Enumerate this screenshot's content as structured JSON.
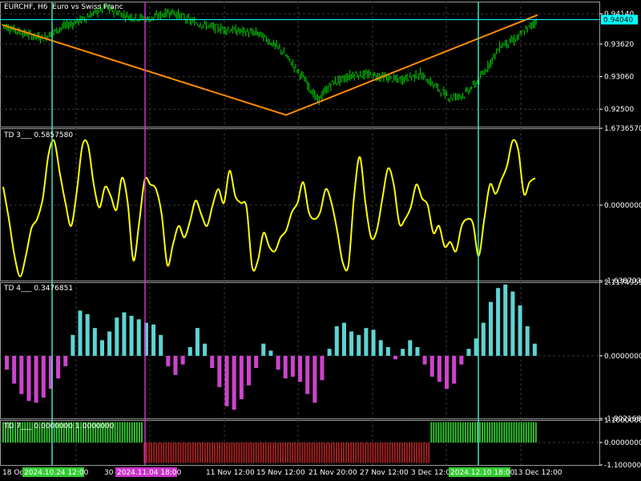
{
  "window": {
    "symbol_label": "EURCHF, H6",
    "description": "Euro vs Swiss Franc"
  },
  "colors": {
    "background": "#000000",
    "grid": "#3a3a3a",
    "candles": "#00e000",
    "trendline": "#ff8c00",
    "vline_cyan": "#40e0c0",
    "vline_magenta": "#cc33cc",
    "td3_line": "#ffff00",
    "td4_up": "#5fd3d3",
    "td4_down": "#cc44cc",
    "td7_up": "#33cc33",
    "td7_down": "#aa2222",
    "price_tag": "#00ffff"
  },
  "price_panel": {
    "current_price_label": "0.94040",
    "axis_labels": [
      "0.94140",
      "0.93620",
      "0.93060",
      "0.92500"
    ],
    "ylim": [
      0.922,
      0.9435
    ]
  },
  "td3_panel": {
    "title": "TD 3___ 0.5857580",
    "axis_labels": [
      "1.6736570",
      "0.0000000",
      "-1.6387039"
    ],
    "ylim": [
      -1.6387039,
      1.673657
    ]
  },
  "td4_panel": {
    "title": "TD 4___ 0.3476851",
    "axis_labels": [
      "2.1174959",
      "0.0000000",
      "-1.8021682"
    ],
    "ylim": [
      -1.8021682,
      2.1174959
    ]
  },
  "td7_panel": {
    "title": "TD 7___ 0.0000000 1.0000000",
    "axis_labels": [
      "1.1000000",
      "0.0000000",
      "-1.1000000"
    ],
    "ylim": [
      -1.1,
      1.1
    ]
  },
  "time_axis": {
    "labels": [
      "18 Oct",
      "30",
      "11 Nov 12:00",
      "15 Nov 12:00",
      "21 Nov 20:00",
      "27 Nov 12:00",
      "3 Dec 12:00",
      "13 Dec 12:00"
    ],
    "highlight_labels": [
      {
        "text": "2024.10.24 12:00",
        "color": "#33cc33"
      },
      {
        "text": "2024.11.04 18:00",
        "color": "#cc33cc"
      },
      {
        "text": "2024.12.10 18:00",
        "color": "#33cc33"
      }
    ]
  },
  "chart_data": [
    {
      "type": "candlestick",
      "title": "EURCHF, H6",
      "ylim": [
        0.922,
        0.9435
      ],
      "price_key_points": [
        [
          0,
          0.9395
        ],
        [
          15,
          0.938
        ],
        [
          28,
          0.9372
        ],
        [
          40,
          0.939
        ],
        [
          55,
          0.9405
        ],
        [
          70,
          0.9425
        ],
        [
          85,
          0.941
        ],
        [
          100,
          0.9405
        ],
        [
          115,
          0.9418
        ],
        [
          130,
          0.94
        ],
        [
          145,
          0.939
        ],
        [
          160,
          0.9385
        ],
        [
          175,
          0.938
        ],
        [
          190,
          0.9352
        ],
        [
          205,
          0.9305
        ],
        [
          215,
          0.9265
        ],
        [
          225,
          0.9295
        ],
        [
          240,
          0.931
        ],
        [
          255,
          0.9308
        ],
        [
          270,
          0.93
        ],
        [
          285,
          0.931
        ],
        [
          295,
          0.929
        ],
        [
          305,
          0.927
        ],
        [
          315,
          0.9275
        ],
        [
          325,
          0.93
        ],
        [
          340,
          0.936
        ],
        [
          350,
          0.937
        ],
        [
          365,
          0.9404
        ]
      ],
      "trendline": [
        [
          0.0,
          0.9395
        ],
        [
          0.53,
          0.924
        ],
        [
          1.0,
          0.9412
        ]
      ]
    },
    {
      "type": "line",
      "title": "TD 3",
      "last_value": 0.585758,
      "ylim": [
        -1.6387039,
        1.673657
      ],
      "values": [
        0.4,
        -0.3,
        -1.1,
        -1.55,
        -1.1,
        -0.5,
        -0.3,
        0.15,
        1.1,
        1.4,
        0.7,
        0.05,
        -0.45,
        0.3,
        1.3,
        1.3,
        0.45,
        -0.05,
        0.4,
        0.2,
        -0.1,
        0.6,
        0.05,
        -1.2,
        -0.4,
        0.55,
        0.45,
        0.35,
        -0.2,
        -1.3,
        -0.85,
        -0.45,
        -0.7,
        -0.35,
        0.1,
        -0.2,
        -0.45,
        0.0,
        0.35,
        0.05,
        0.75,
        0.2,
        0.05,
        -0.05,
        -1.35,
        -1.2,
        -0.6,
        -0.9,
        -1.0,
        -0.7,
        -0.55,
        -0.15,
        0.05,
        0.5,
        -0.15,
        -0.3,
        -0.15,
        0.35,
        0.05,
        -0.55,
        -1.25,
        -1.3,
        0.2,
        1.05,
        0.05,
        -0.7,
        -0.55,
        0.15,
        0.8,
        0.45,
        -0.4,
        -0.3,
        -0.05,
        0.45,
        0.15,
        0.0,
        -0.6,
        -0.45,
        -0.9,
        -0.8,
        -1.0,
        -0.45,
        -0.3,
        -0.4,
        -1.1,
        -0.3,
        0.45,
        0.25,
        0.55,
        0.85,
        1.4,
        1.2,
        0.25,
        0.5,
        0.59
      ]
    },
    {
      "type": "bar",
      "title": "TD 4",
      "last_value": 0.3476851,
      "ylim": [
        -1.8021682,
        2.1174959
      ],
      "values": [
        -0.4,
        -0.8,
        -1.1,
        -1.3,
        -1.35,
        -1.2,
        -0.95,
        -0.65,
        -0.3,
        0.6,
        1.3,
        1.2,
        0.8,
        0.45,
        0.7,
        1.1,
        1.25,
        1.15,
        1.05,
        0.95,
        0.9,
        0.6,
        -0.3,
        -0.55,
        -0.25,
        0.25,
        0.8,
        0.35,
        -0.35,
        -0.9,
        -1.45,
        -1.55,
        -1.25,
        -0.85,
        -0.35,
        0.35,
        0.15,
        -0.4,
        -0.65,
        -0.6,
        -0.75,
        -1.1,
        -1.35,
        -0.7,
        0.2,
        0.85,
        0.95,
        0.7,
        0.6,
        0.8,
        0.75,
        0.45,
        0.25,
        -0.1,
        0.2,
        0.45,
        0.25,
        -0.25,
        -0.6,
        -0.75,
        -0.95,
        -0.8,
        -0.25,
        0.2,
        0.5,
        0.95,
        1.55,
        1.95,
        2.05,
        1.85,
        1.45,
        0.85,
        0.35
      ]
    },
    {
      "type": "bar",
      "title": "TD 7",
      "values_series_1": "0 until first magenta line, then 1 (green up bars) near start and end",
      "segments": [
        {
          "state": 1,
          "from": 0.0,
          "to": 0.26
        },
        {
          "state": -1,
          "from": 0.26,
          "to": 0.8
        },
        {
          "state": 1,
          "from": 0.8,
          "to": 1.0
        }
      ]
    }
  ]
}
